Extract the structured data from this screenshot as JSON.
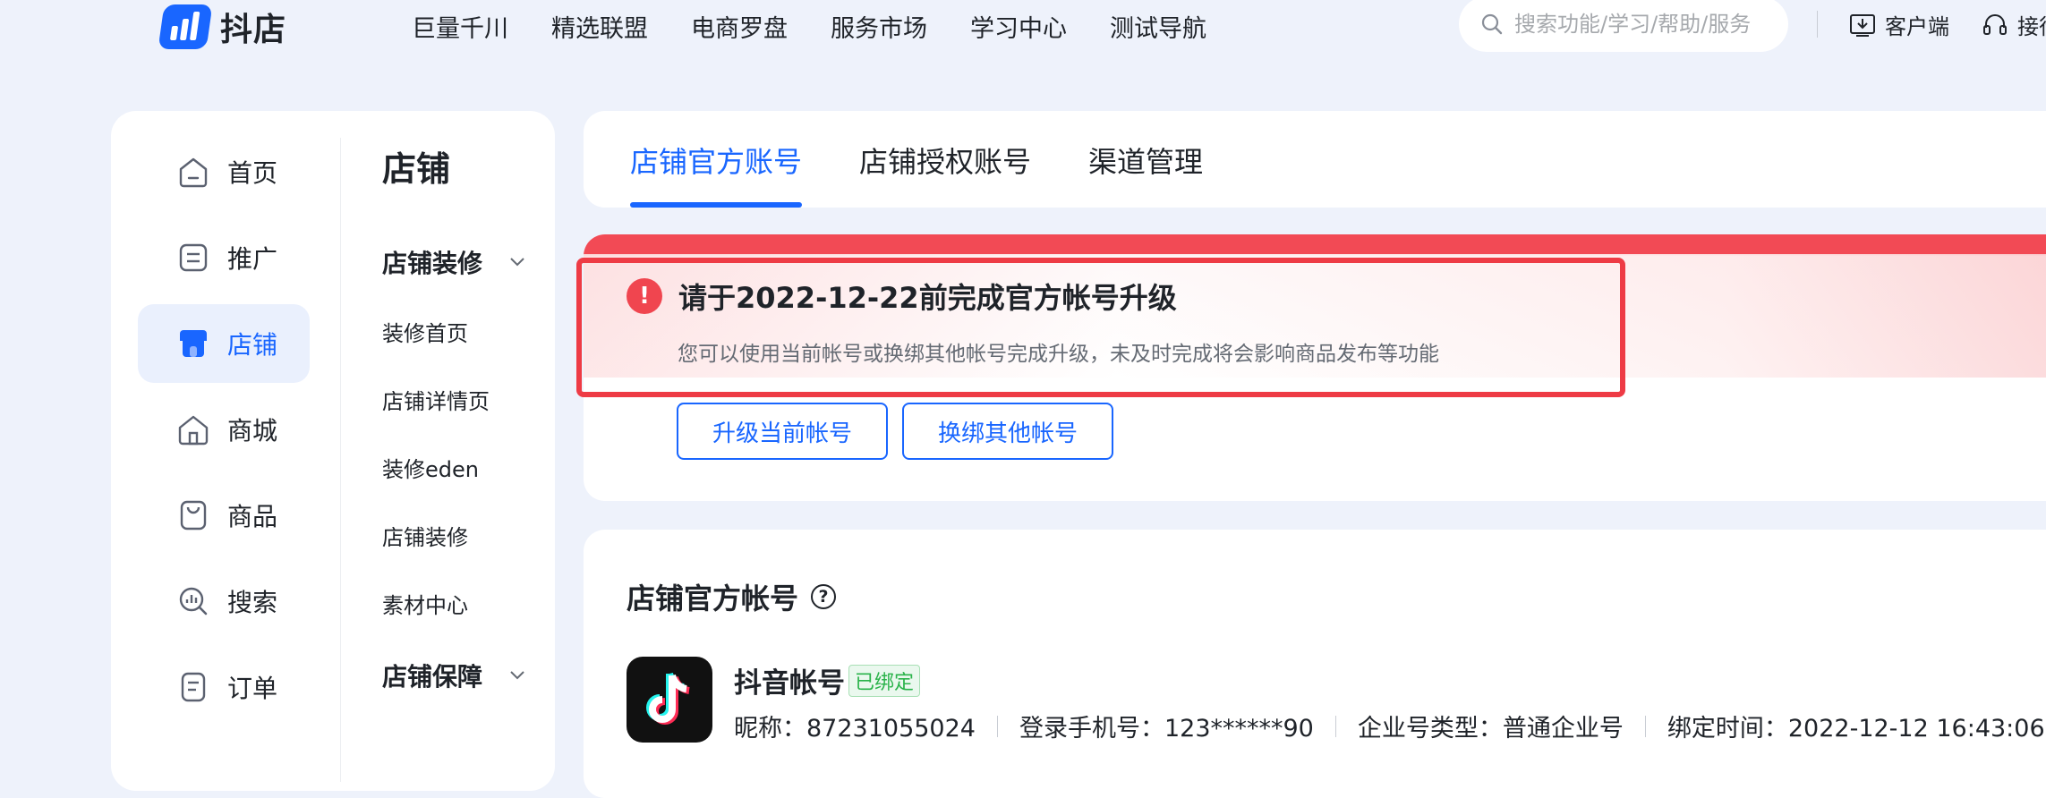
{
  "brand": {
    "name": "抖店",
    "color": "#1966ff"
  },
  "top_nav": {
    "links": [
      "巨量千川",
      "精选联盟",
      "电商罗盘",
      "服务市场",
      "学习中心",
      "测试导航"
    ],
    "search_placeholder": "搜索功能/学习/帮助/服务",
    "client_label": "客户端",
    "service_label": "接待"
  },
  "sidebar": {
    "items": [
      {
        "label": "首页",
        "icon": "home-icon"
      },
      {
        "label": "推广",
        "icon": "promote-icon"
      },
      {
        "label": "店铺",
        "icon": "shop-icon",
        "active": true
      },
      {
        "label": "商城",
        "icon": "mall-icon"
      },
      {
        "label": "商品",
        "icon": "product-icon"
      },
      {
        "label": "搜索",
        "icon": "search-analytics-icon"
      },
      {
        "label": "订单",
        "icon": "order-icon"
      }
    ]
  },
  "sub_menu": {
    "title": "店铺",
    "group1": "店铺装修",
    "items": [
      "装修首页",
      "店铺详情页",
      "装修eden",
      "店铺装修",
      "素材中心"
    ],
    "group2": "店铺保障"
  },
  "tabs": [
    "店铺官方账号",
    "店铺授权账号",
    "渠道管理"
  ],
  "alert": {
    "title": "请于2022-12-22前完成官方帐号升级",
    "description": "您可以使用当前帐号或换绑其他帐号完成升级，未及时完成将会影响商品发布等功能",
    "btn_upgrade": "升级当前帐号",
    "btn_rebind": "换绑其他帐号",
    "color": "#f0454f"
  },
  "account": {
    "section_title": "店铺官方帐号",
    "name": "抖音帐号",
    "badge": "已绑定",
    "nickname": "昵称：87231055024",
    "phone": "登录手机号：123******90",
    "company_type": "企业号类型：普通企业号",
    "bind_time": "绑定时间：2022-12-12 16:43:06"
  }
}
